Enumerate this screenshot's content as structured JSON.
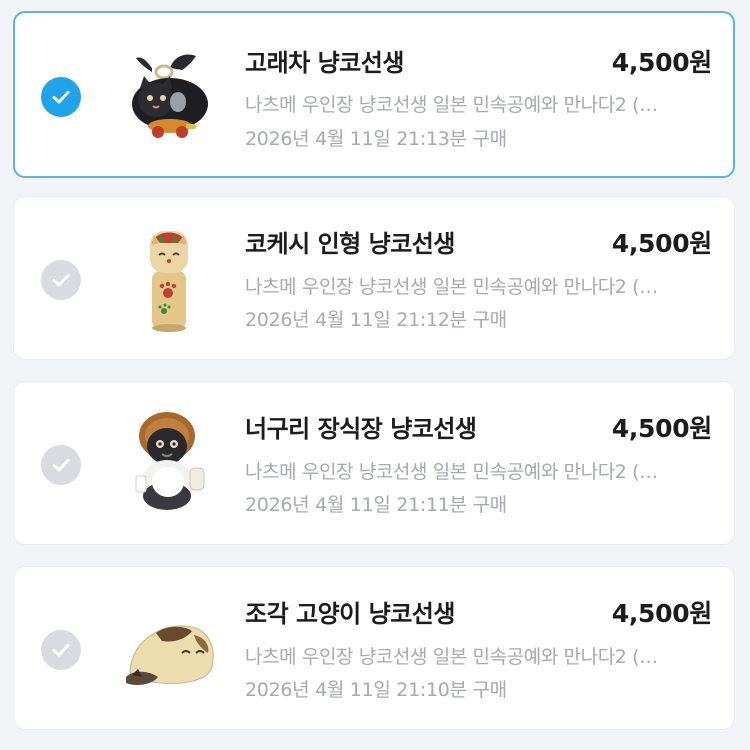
{
  "theme": {
    "background": "#f1f3f7",
    "card_background": "#ffffff",
    "selected_border": "#5ab4e6",
    "check_selected": "#1fa3eb",
    "check_unselected": "#d9dbe1",
    "title_color": "#1c1c1e",
    "secondary_text": "#a7a9b0"
  },
  "items": [
    {
      "selected": true,
      "icon": "black-cat-whale-figurine",
      "title": "고래차 냥코선생",
      "price": "4,500원",
      "description": "나츠메 우인장 냥코선생 일본 민속공예와 만나다2 (…",
      "purchased": "2026년 4월 11일 21:13분 구매"
    },
    {
      "selected": false,
      "icon": "kokeshi-doll-figurine",
      "title": "코케시 인형 냥코선생",
      "price": "4,500원",
      "description": "나츠메 우인장 냥코선생 일본 민속공예와 만나다2 (…",
      "purchased": "2026년 4월 11일 21:12분 구매"
    },
    {
      "selected": false,
      "icon": "tanuki-ornament-figurine",
      "title": "너구리 장식장 냥코선생",
      "price": "4,500원",
      "description": "나츠메 우인장 냥코선생 일본 민속공예와 만나다2 (…",
      "purchased": "2026년 4월 11일 21:11분 구매"
    },
    {
      "selected": false,
      "icon": "carved-cat-figurine",
      "title": "조각 고양이 냥코선생",
      "price": "4,500원",
      "description": "나츠메 우인장 냥코선생 일본 민속공예와 만나다2 (…",
      "purchased": "2026년 4월 11일 21:10분 구매"
    }
  ]
}
